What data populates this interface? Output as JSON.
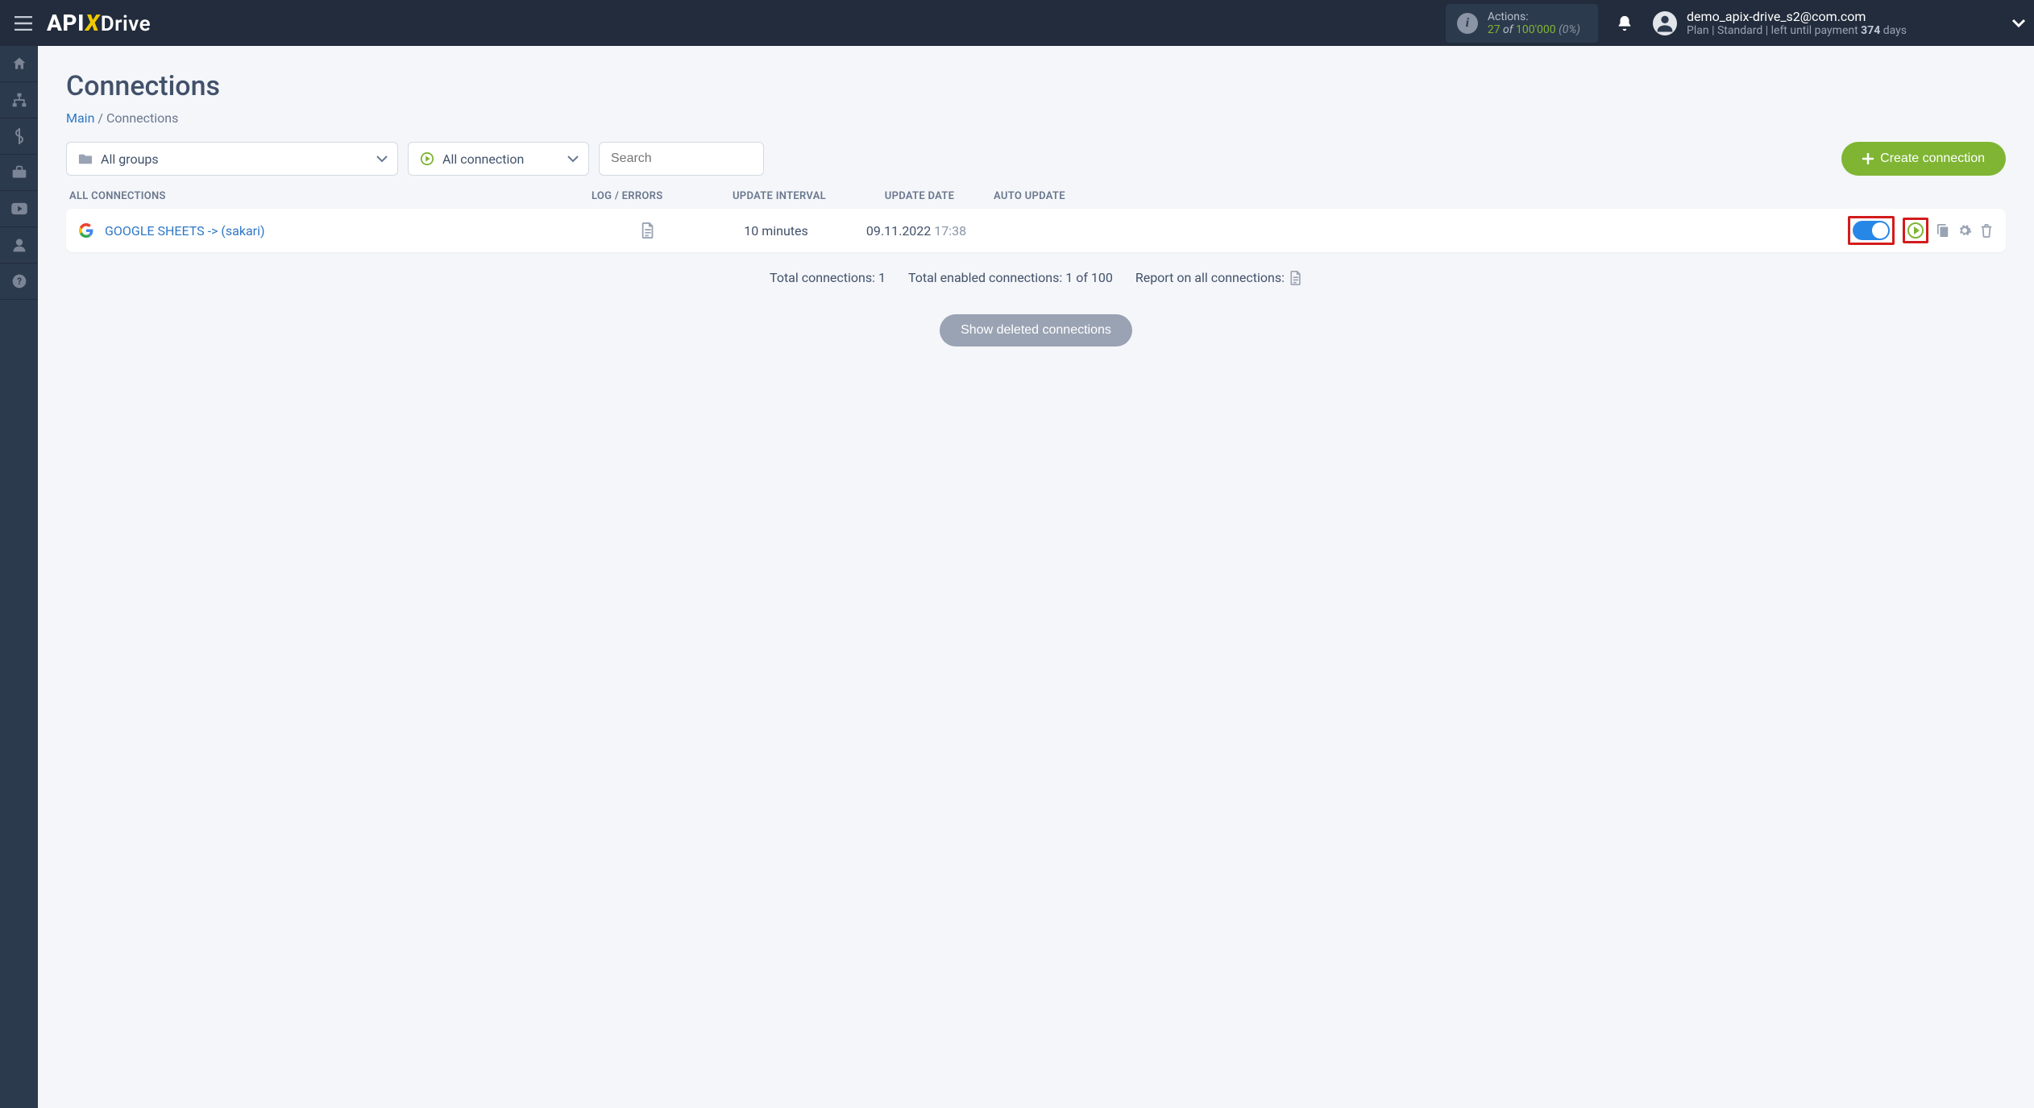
{
  "topbar": {
    "actions_label": "Actions:",
    "actions_current": "27",
    "actions_of": " of ",
    "actions_max": "100'000",
    "actions_pct": " (0%)",
    "user_email": "demo_apix-drive_s2@com.com",
    "plan_prefix": "Plan  | ",
    "plan_name": "Standard",
    "plan_mid": " |  left until payment ",
    "plan_days": "374",
    "plan_suffix": " days"
  },
  "page": {
    "title": "Connections",
    "breadcrumb_main": "Main",
    "breadcrumb_sep": "  /  ",
    "breadcrumb_current": "Connections"
  },
  "filters": {
    "groups": "All groups",
    "status": "All connection",
    "search_placeholder": "Search",
    "create_label": "Create connection"
  },
  "columns": {
    "name": "All connections",
    "log": "Log / Errors",
    "interval": "Update interval",
    "date": "Update date",
    "auto": "Auto update"
  },
  "row": {
    "name": "GOOGLE SHEETS -> (sakari)",
    "interval": "10 minutes",
    "date": "09.11.2022",
    "time": " 17:38"
  },
  "summary": {
    "total": "Total connections: 1",
    "enabled": "Total enabled connections: 1 of 100",
    "report": "Report on all connections: "
  },
  "buttons": {
    "show_deleted": "Show deleted connections"
  }
}
